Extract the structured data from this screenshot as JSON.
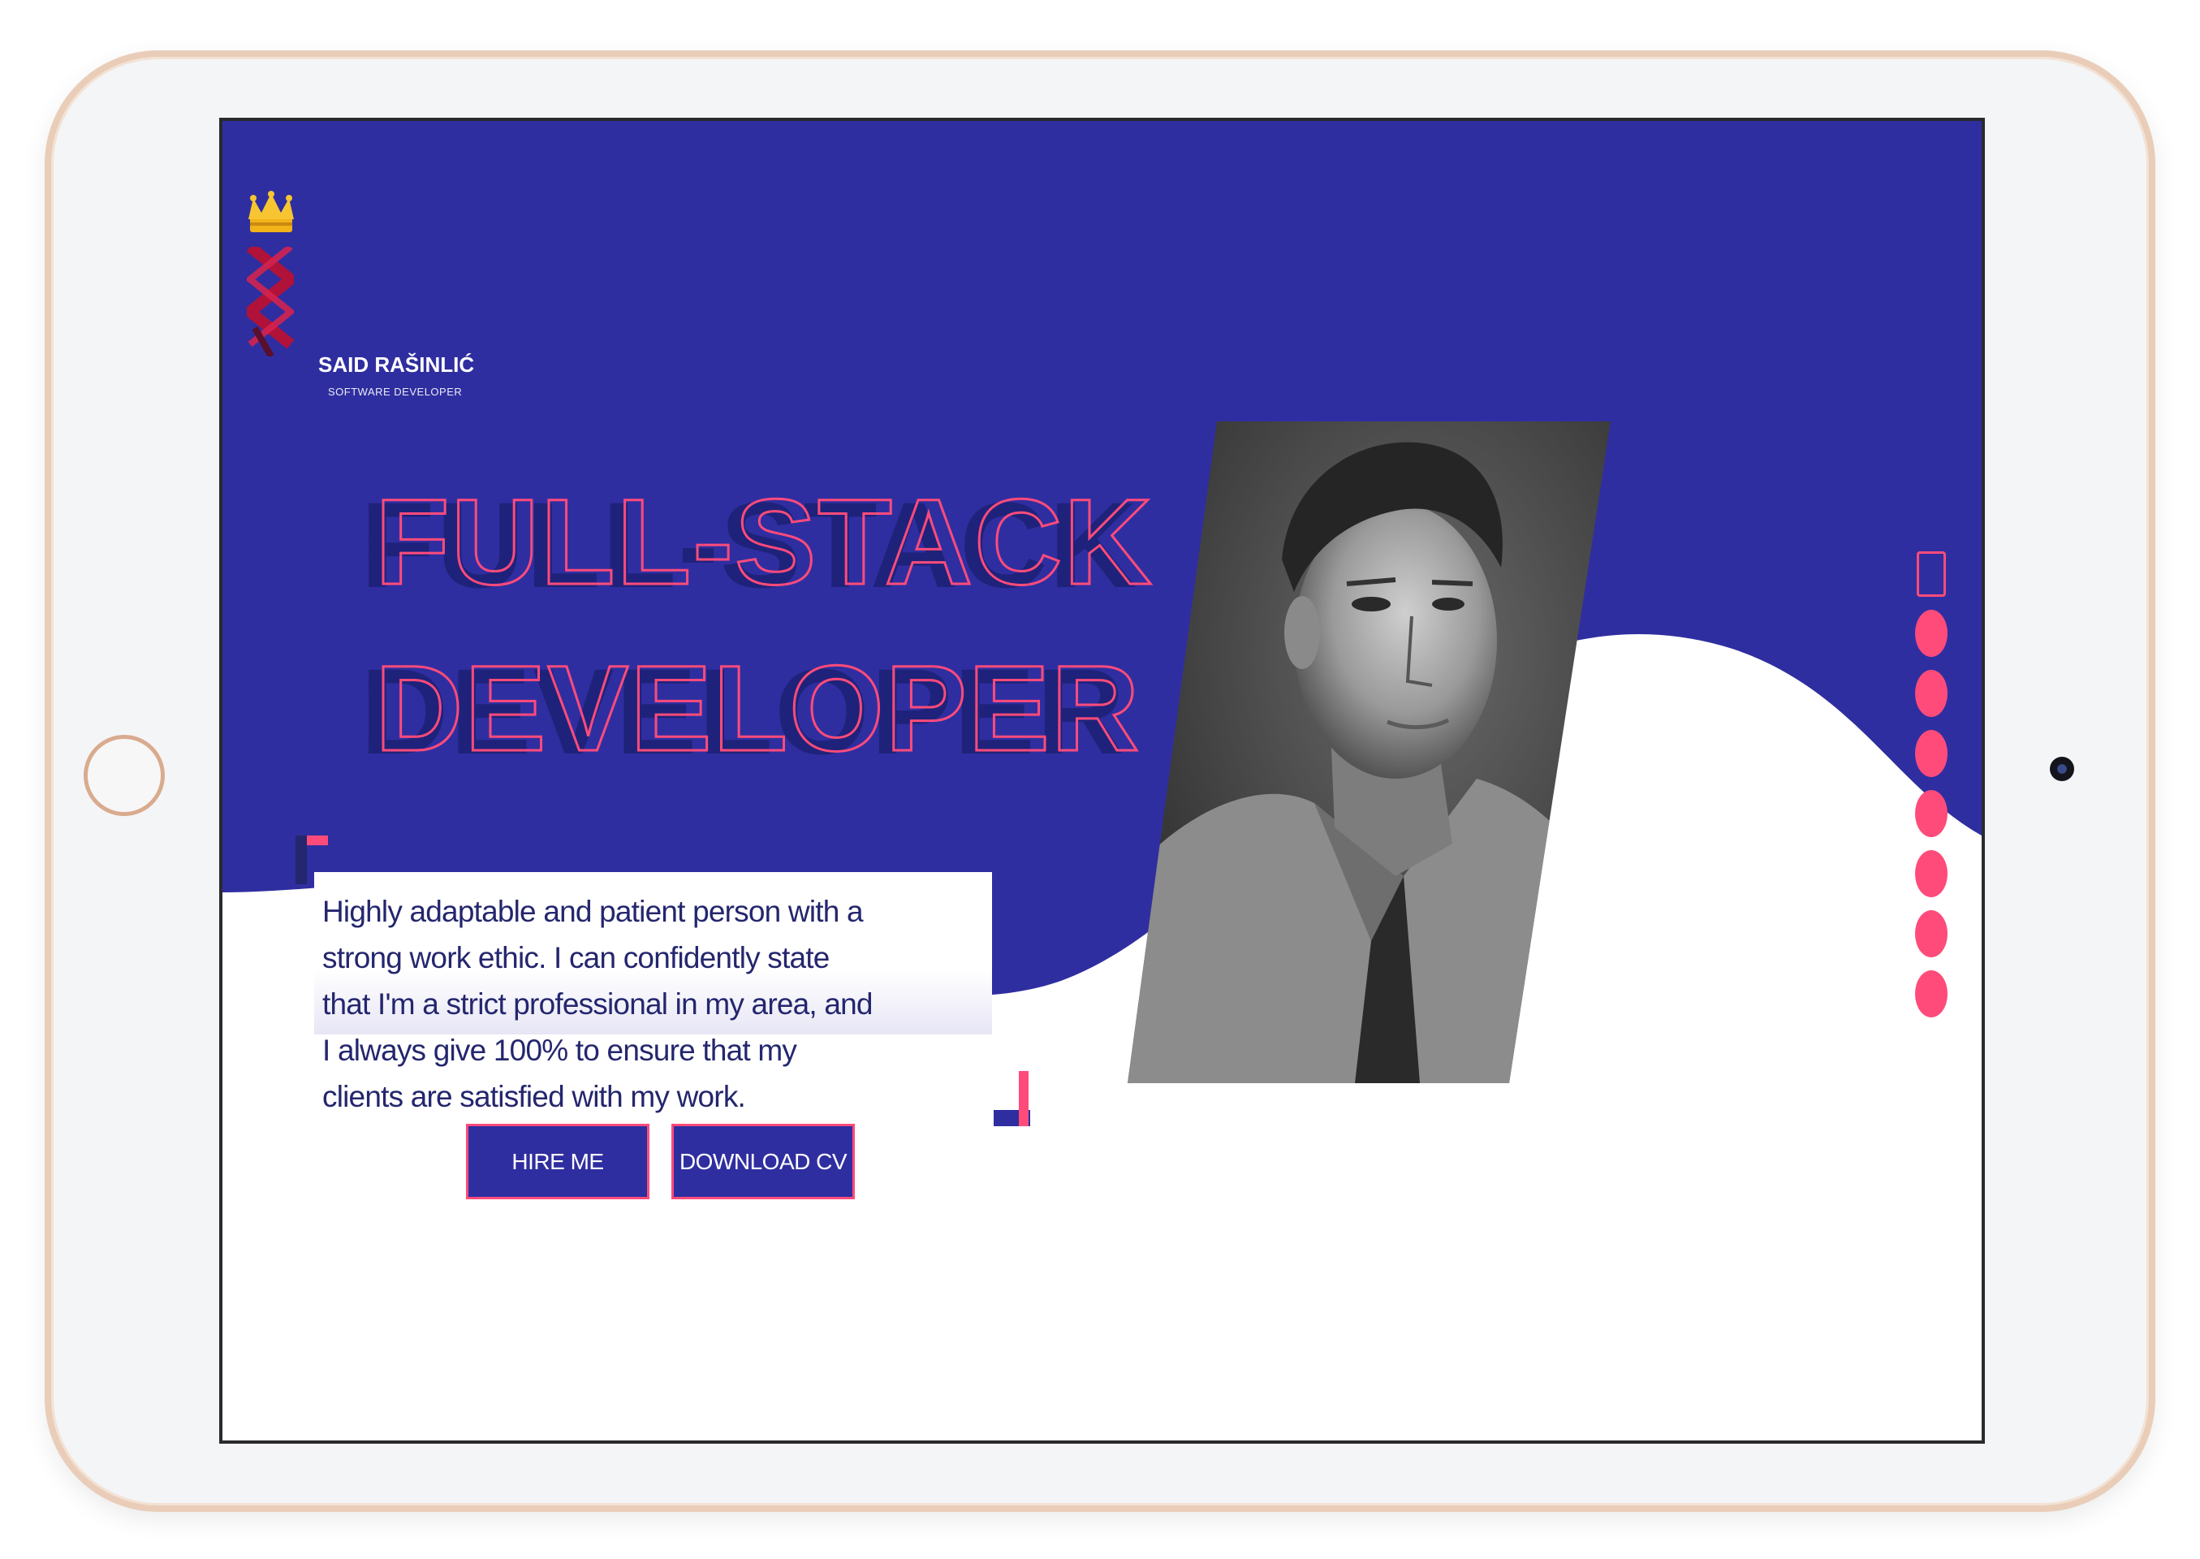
{
  "brand": {
    "name": "SAID RAŠINLIĆ",
    "role": "SOFTWARE DEVELOPER"
  },
  "hero": {
    "headline_line1": "FULL-STACK",
    "headline_line2": "DEVELOPER",
    "description": "Highly adaptable and patient person with a strong work ethic. I can confidently state that I'm a strict professional in my area, and I always give 100% to ensure that my clients are satisfied with my work."
  },
  "buttons": {
    "hire_label": "HIRE ME",
    "cv_label": "DOWNLOAD CV"
  },
  "colors": {
    "primary": "#2f2ea0",
    "accent": "#ff4b7a",
    "dark_text": "#24266e"
  },
  "icons": {
    "crown": "crown-icon",
    "logo_mark": "logo-mark-icon"
  }
}
